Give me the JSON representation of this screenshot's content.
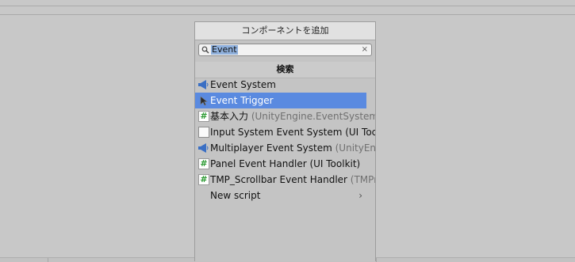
{
  "dialog": {
    "title": "コンポーネントを追加"
  },
  "search": {
    "value": "Event",
    "clear_glyph": "×"
  },
  "section": {
    "title": "検索"
  },
  "items": [
    {
      "label": "Event System",
      "suffix": "",
      "icon": "megaphone-icon"
    },
    {
      "label": "Event Trigger",
      "suffix": "",
      "icon": "cursor-icon"
    },
    {
      "label": "基本入力",
      "suffix": " (UnityEngine.EventSystems)",
      "icon": "script-hash-icon"
    },
    {
      "label": "Input System Event System (UI Toc",
      "suffix": "",
      "icon": "document-icon"
    },
    {
      "label": "Multiplayer Event System",
      "suffix": " (UnityEngin",
      "icon": "megaphone-icon"
    },
    {
      "label": "Panel Event Handler (UI Toolkit)",
      "suffix": "",
      "icon": "script-hash-icon"
    },
    {
      "label": "TMP_Scrollbar Event Handler",
      "suffix": " (TMPro",
      "icon": "script-hash-icon"
    },
    {
      "label": "New script",
      "suffix": "",
      "icon": ""
    }
  ],
  "new_script_chevron": "›",
  "colors": {
    "selection": "#5a8ae0",
    "search_highlight": "#8fb0dc",
    "script_hash": "#2e9b34"
  }
}
